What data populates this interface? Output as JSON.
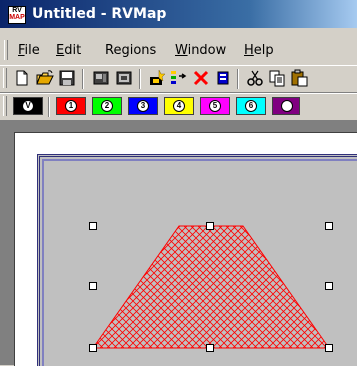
{
  "window": {
    "title": "Untitled - RVMap",
    "icon_text_top": "RV",
    "icon_text_bottom": "MAP"
  },
  "menu": [
    {
      "label": "File",
      "key": "F",
      "rest": "ile"
    },
    {
      "label": "Edit",
      "key": "E",
      "rest": "dit"
    },
    {
      "label": "Regions",
      "key": "R",
      "rest": "egions"
    },
    {
      "label": "Window",
      "key": "W",
      "rest": "indow"
    },
    {
      "label": "Help",
      "key": "H",
      "rest": "elp"
    }
  ],
  "toolbar1": {
    "buttons": [
      "new-icon",
      "open-icon",
      "save-icon",
      "map-icon",
      "map2-icon",
      "add-region-icon",
      "list-region-icon",
      "delete-icon",
      "properties-icon",
      "cut-icon",
      "copy-icon"
    ]
  },
  "region_buttons": [
    {
      "label": "V",
      "color": "#000000"
    },
    {
      "label": "1",
      "color": "#ff0000"
    },
    {
      "label": "2",
      "color": "#00ff00"
    },
    {
      "label": "3",
      "color": "#0000ff"
    },
    {
      "label": "4",
      "color": "#ffff00"
    },
    {
      "label": "5",
      "color": "#ff00ff"
    },
    {
      "label": "6",
      "color": "#00ffff"
    },
    {
      "label": "",
      "color": "#800080"
    }
  ],
  "region_shape": {
    "color": "#ff0000",
    "pattern": "crosshatch"
  }
}
